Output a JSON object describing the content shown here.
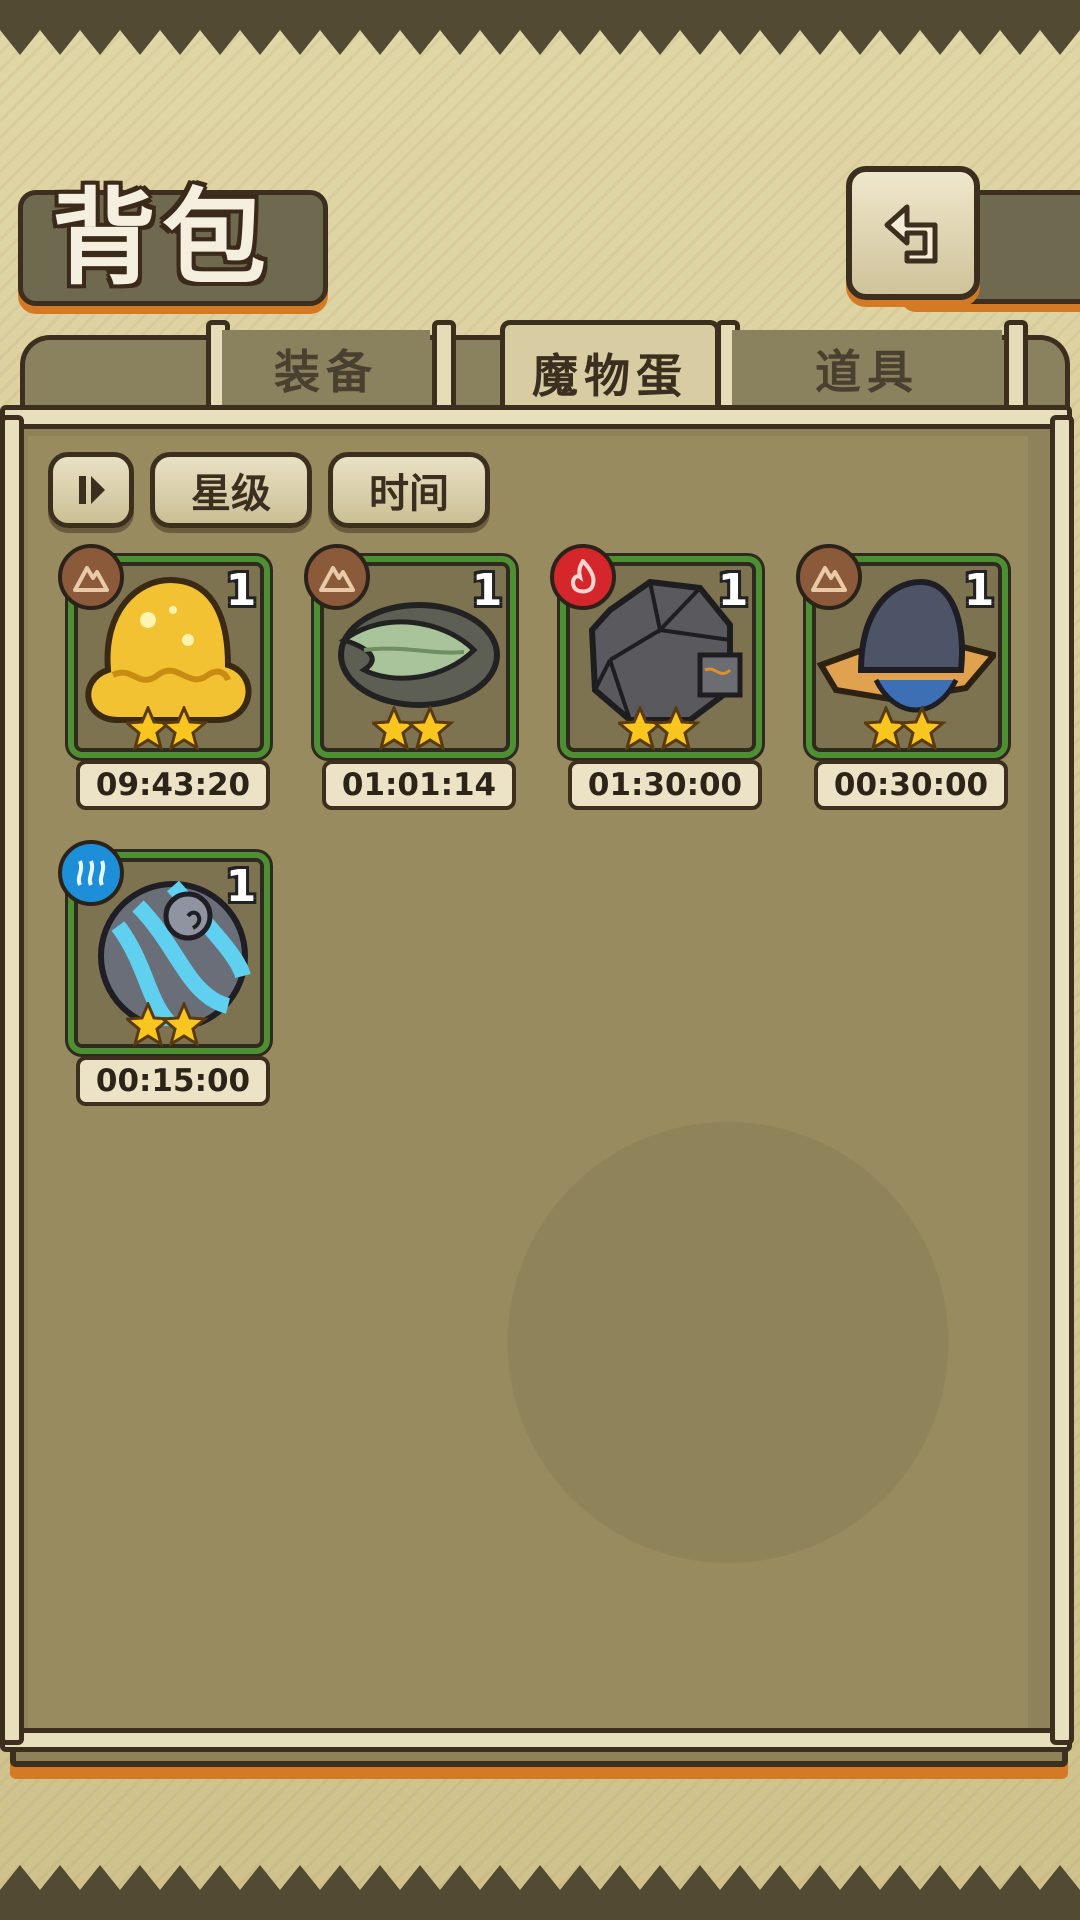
{
  "header": {
    "title": "背包"
  },
  "tabs": [
    {
      "label": "装备",
      "active": false
    },
    {
      "label": "魔物蛋",
      "active": true
    },
    {
      "label": "道具",
      "active": false
    }
  ],
  "filters": {
    "toggle_icon": "sort-toggle-icon",
    "star_label": "星级",
    "time_label": "时间"
  },
  "eggs": [
    {
      "count": "1",
      "time": "09:43:20",
      "stars": 2,
      "element": "earth",
      "icon": "gold-slime-egg-icon"
    },
    {
      "count": "1",
      "time": "01:01:14",
      "stars": 2,
      "element": "earth",
      "icon": "leaf-egg-icon"
    },
    {
      "count": "1",
      "time": "01:30:00",
      "stars": 2,
      "element": "fire",
      "icon": "stone-golem-egg-icon"
    },
    {
      "count": "1",
      "time": "00:30:00",
      "stars": 2,
      "element": "earth",
      "icon": "hat-egg-icon"
    },
    {
      "count": "1",
      "time": "00:15:00",
      "stars": 2,
      "element": "water",
      "icon": "shell-egg-icon"
    }
  ],
  "colors": {
    "accent_orange": "#d47a25",
    "card_border_green": "#4f8f33",
    "earth_badge": "#8a5a3a",
    "fire_badge": "#d4262b",
    "water_badge": "#1d8fd8"
  }
}
